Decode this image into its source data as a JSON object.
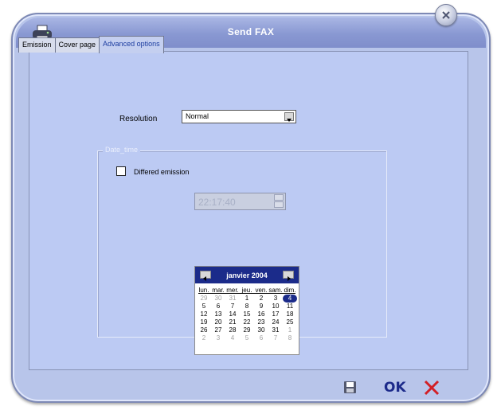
{
  "window": {
    "title": "Send FAX"
  },
  "tabs": [
    {
      "label": "Emission"
    },
    {
      "label": "Cover page"
    },
    {
      "label": "Advanced options"
    }
  ],
  "resolution": {
    "label": "Resolution",
    "value": "Normal"
  },
  "date_time": {
    "legend": "Date_time",
    "differed_label": "Differed emission",
    "time_value": "22:17:40"
  },
  "calendar": {
    "title": "janvier 2004",
    "weekdays": [
      "lun.",
      "mar.",
      "mer.",
      "jeu.",
      "ven.",
      "sam.",
      "dim."
    ],
    "weeks": [
      [
        "29",
        "30",
        "31",
        "1",
        "2",
        "3",
        "4"
      ],
      [
        "5",
        "6",
        "7",
        "8",
        "9",
        "10",
        "11"
      ],
      [
        "12",
        "13",
        "14",
        "15",
        "16",
        "17",
        "18"
      ],
      [
        "19",
        "20",
        "21",
        "22",
        "23",
        "24",
        "25"
      ],
      [
        "26",
        "27",
        "28",
        "29",
        "30",
        "31",
        "1"
      ],
      [
        "2",
        "3",
        "4",
        "5",
        "6",
        "7",
        "8"
      ]
    ],
    "selected_day": "4"
  },
  "footer": {
    "ok_label": "OK"
  },
  "icons": [
    "printer-icon",
    "close-icon",
    "save-icon",
    "cancel-icon"
  ],
  "colors": {
    "accent": "#1b2b8a",
    "panel": "#bccaf3",
    "titlebar": "#8998d2"
  }
}
